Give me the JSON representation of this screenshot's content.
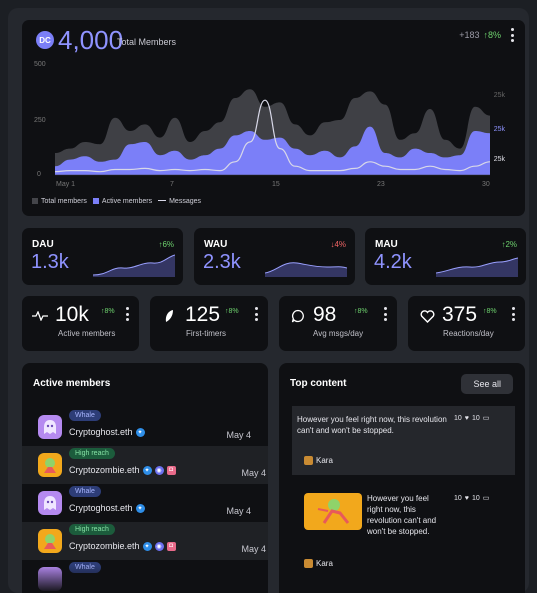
{
  "header": {
    "logo_text": "DC",
    "total_members": "4,000",
    "total_label": "Total Members",
    "delta_count": "+183",
    "delta_pct": "↑8%"
  },
  "chart_data": {
    "type": "area",
    "x": [
      1,
      2,
      3,
      4,
      5,
      6,
      7,
      8,
      9,
      10,
      11,
      12,
      13,
      14,
      15,
      16,
      17,
      18,
      19,
      20,
      21,
      22,
      23,
      24,
      25,
      26,
      27,
      28,
      29,
      30
    ],
    "x_tick_labels": [
      "May 1",
      "7",
      "15",
      "23",
      "30"
    ],
    "y_left_ticks": [
      "500",
      "250",
      "0"
    ],
    "y_right_ticks": [
      "25k",
      "25k",
      "25k"
    ],
    "ylim": [
      0,
      500
    ],
    "series": [
      {
        "name": "Total members",
        "color": "#3f4045",
        "values": [
          100,
          120,
          150,
          140,
          260,
          200,
          230,
          170,
          260,
          150,
          200,
          240,
          350,
          390,
          310,
          330,
          230,
          180,
          240,
          250,
          350,
          380,
          320,
          160,
          190,
          300,
          160,
          120,
          310,
          270
        ]
      },
      {
        "name": "Active members",
        "color": "#7b7ff8",
        "values": [
          40,
          70,
          85,
          60,
          70,
          140,
          150,
          90,
          110,
          70,
          90,
          120,
          180,
          200,
          160,
          170,
          120,
          90,
          110,
          80,
          130,
          220,
          100,
          80,
          120,
          100,
          80,
          90,
          200,
          190
        ]
      },
      {
        "name": "Messages",
        "color": "#d8d8e8",
        "values": [
          15,
          20,
          20,
          15,
          25,
          25,
          30,
          20,
          25,
          20,
          25,
          20,
          60,
          150,
          340,
          120,
          40,
          20,
          20,
          20,
          30,
          60,
          40,
          25,
          25,
          40,
          25,
          20,
          40,
          60
        ]
      }
    ],
    "legend": "bottom-left",
    "grid": false
  },
  "metrics": [
    {
      "name": "DAU",
      "value": "1.3k",
      "change": "↑6%",
      "up": true
    },
    {
      "name": "WAU",
      "value": "2.3k",
      "change": "↓4%",
      "up": false
    },
    {
      "name": "MAU",
      "value": "4.2k",
      "change": "↑2%",
      "up": true
    }
  ],
  "stats": [
    {
      "value": "10k",
      "change": "↑8%",
      "label": "Active members",
      "icon": "activity-icon"
    },
    {
      "value": "125",
      "change": "↑8%",
      "label": "First-timers",
      "icon": "leaf-icon"
    },
    {
      "value": "98",
      "change": "↑8%",
      "label": "Avg msgs/day",
      "icon": "chat-bubble-icon"
    },
    {
      "value": "375",
      "change": "↑8%",
      "label": "Reactions/day",
      "icon": "heart-icon"
    }
  ],
  "active_members": {
    "title": "Active members",
    "rows": [
      {
        "tag": "Whale",
        "name": "Cryptoghost.eth",
        "date": "May 4"
      },
      {
        "tag": "High reach",
        "name": "Cryptozombie.eth",
        "date": "May 4"
      },
      {
        "tag": "Whale",
        "name": "Cryptoghost.eth",
        "date": "May 4"
      },
      {
        "tag": "High reach",
        "name": "Cryptozombie.eth",
        "date": "May 4"
      },
      {
        "tag": "Whale",
        "name": "",
        "date": ""
      }
    ]
  },
  "top_content": {
    "title": "Top content",
    "see_all": "See all",
    "items": [
      {
        "text": "However you feel right now, this revolution can't and won't be stopped.",
        "likes": "10",
        "comments": "10",
        "author": "Kara"
      },
      {
        "text": "However you feel right now, this revolution can't and won't be stopped.",
        "likes": "10",
        "comments": "10",
        "author": "Kara"
      }
    ]
  },
  "colors": {
    "accent": "#8f93ff",
    "up": "#6ed26e",
    "down": "#f06565",
    "card": "#0f1013"
  }
}
